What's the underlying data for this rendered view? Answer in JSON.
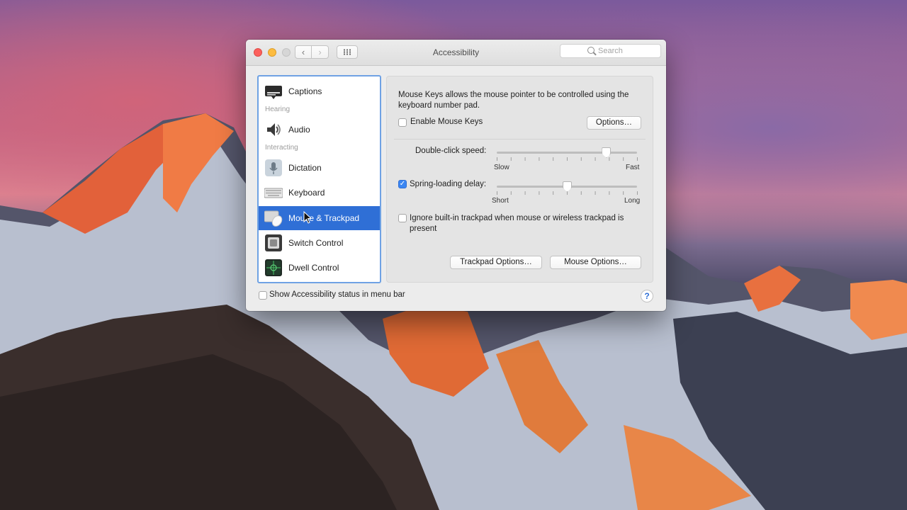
{
  "window": {
    "title": "Accessibility",
    "search_placeholder": "Search",
    "nav": {
      "back": "‹",
      "forward": "›"
    }
  },
  "sidebar": {
    "items": [
      {
        "label": "Captions",
        "icon": "captions-icon"
      },
      {
        "header": "Hearing"
      },
      {
        "label": "Audio",
        "icon": "speaker-icon"
      },
      {
        "header": "Interacting"
      },
      {
        "label": "Dictation",
        "icon": "microphone-icon"
      },
      {
        "label": "Keyboard",
        "icon": "keyboard-icon"
      },
      {
        "label": "Mouse & Trackpad",
        "icon": "mouse-trackpad-icon",
        "selected": true
      },
      {
        "label": "Switch Control",
        "icon": "switch-control-icon"
      },
      {
        "label": "Dwell Control",
        "icon": "dwell-control-icon"
      }
    ]
  },
  "panel": {
    "description": "Mouse Keys allows the mouse pointer to be controlled using the keyboard number pad.",
    "enable_mouse_keys": {
      "label": "Enable Mouse Keys",
      "checked": false
    },
    "options_button": "Options…",
    "double_click": {
      "label": "Double-click speed:",
      "min_label": "Slow",
      "max_label": "Fast",
      "value": 0.78
    },
    "spring_loading": {
      "label": "Spring-loading delay:",
      "checked": true,
      "min_label": "Short",
      "max_label": "Long",
      "value": 0.5
    },
    "ignore_trackpad": {
      "label": "Ignore built-in trackpad when mouse or wireless trackpad is present",
      "checked": false
    },
    "trackpad_options_button": "Trackpad Options…",
    "mouse_options_button": "Mouse Options…"
  },
  "footer": {
    "show_status": {
      "label": "Show Accessibility status in menu bar",
      "checked": false
    },
    "help": "?"
  },
  "colors": {
    "accent": "#2f6fd6",
    "close": "#fc605c",
    "minimize": "#fdbc40"
  }
}
